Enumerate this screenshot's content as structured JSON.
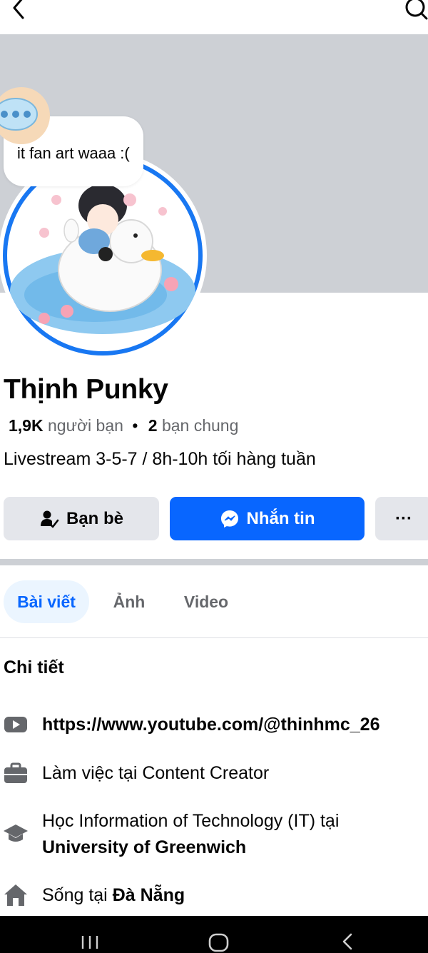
{
  "profile": {
    "note": "it fan art waaa :(",
    "name": "Thịnh Punky",
    "friends_count": "1,9K",
    "friends_label": "người bạn",
    "separator": "•",
    "mutual_count": "2",
    "mutual_label": "bạn chung",
    "bio": "Livestream 3-5-7 / 8h-10h tối hàng tuần"
  },
  "actions": {
    "friends_label": "Bạn bè",
    "message_label": "Nhắn tin",
    "more_label": "···"
  },
  "tabs": [
    {
      "label": "Bài viết",
      "active": true
    },
    {
      "label": "Ảnh",
      "active": false
    },
    {
      "label": "Video",
      "active": false
    }
  ],
  "details": {
    "title": "Chi tiết",
    "youtube_link": "https://www.youtube.com/@thinhmc_26",
    "work": "Làm việc tại Content Creator",
    "study_prefix": "Học Information of Technology (IT) tại",
    "study_school": "University of Greenwich",
    "lives_prefix": "Sống tại",
    "lives_city": "Đà Nẵng"
  },
  "icons": {
    "back": "back-arrow-icon",
    "search": "search-icon",
    "note": "chat-bubble-icon",
    "friends": "person-check-icon",
    "message": "messenger-icon",
    "youtube": "youtube-icon",
    "work": "briefcase-icon",
    "study": "graduation-cap-icon",
    "home": "home-icon"
  },
  "colors": {
    "accent": "#0866ff",
    "cover": "#cdd0d5",
    "secondary_button": "#e4e6eb",
    "active_tab_bg": "#ebf5ff",
    "muted_text": "#65676b"
  }
}
